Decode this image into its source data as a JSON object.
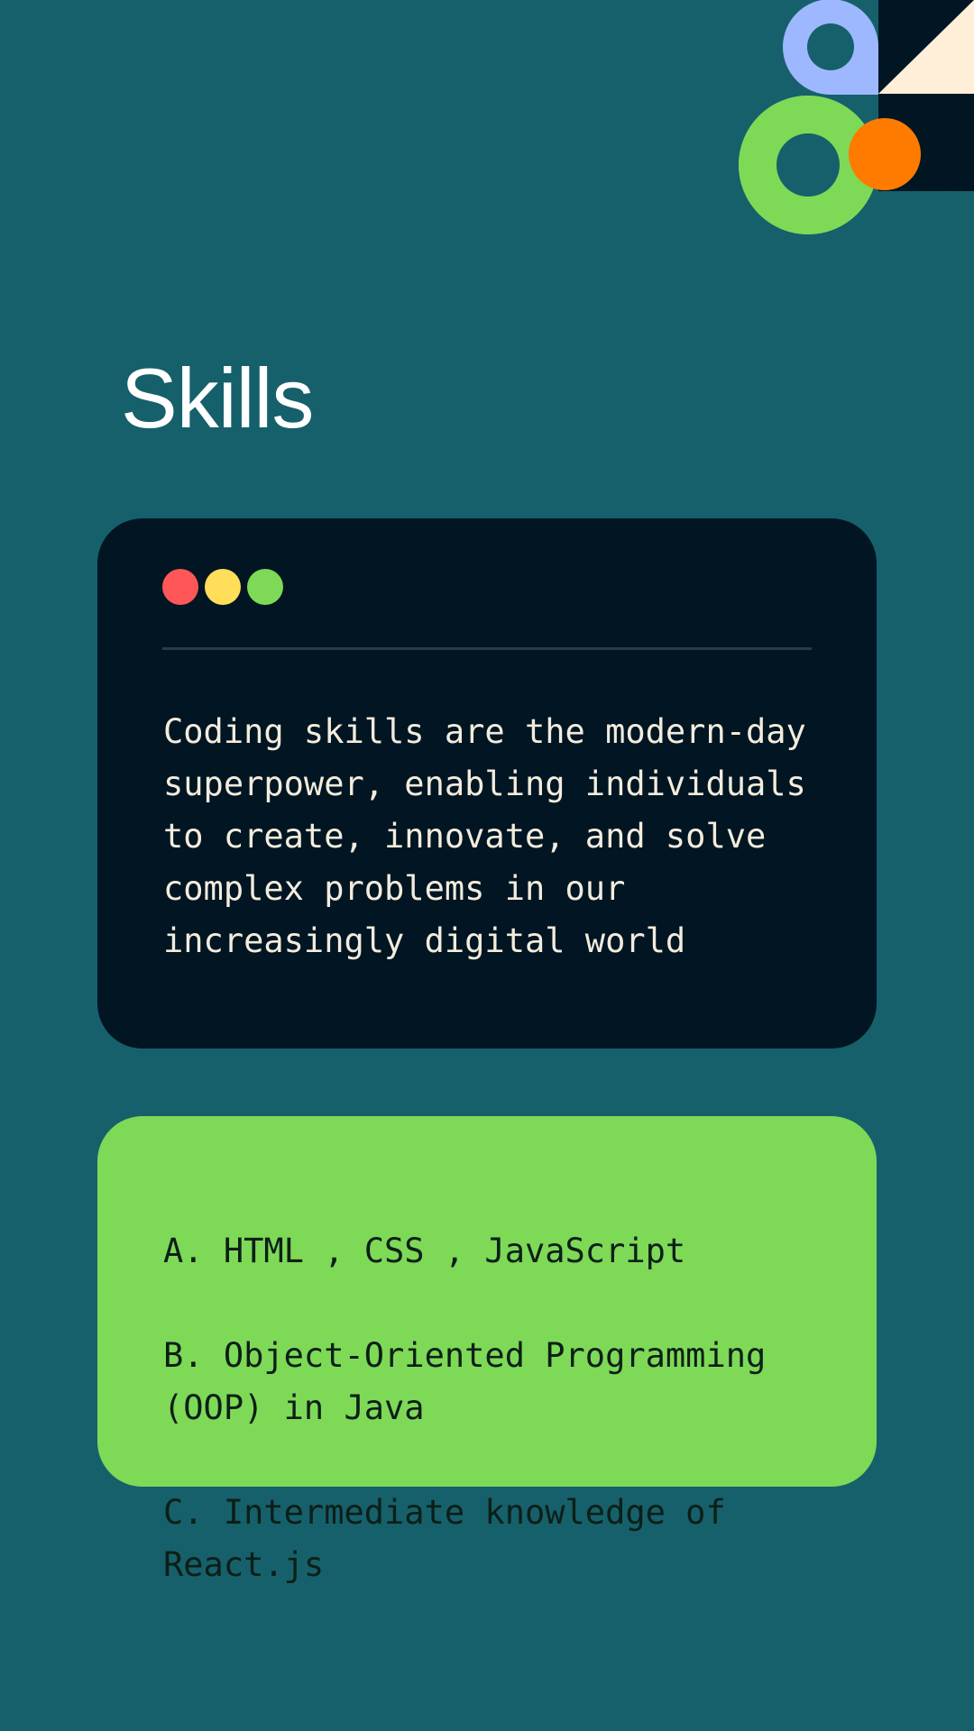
{
  "page": {
    "title": "Skills"
  },
  "colors": {
    "background": "#16606b",
    "terminal_bg": "#011523",
    "terminal_text": "#f3ecdc",
    "skills_bg": "#7ed957",
    "skills_text": "#0b1f17",
    "dot_red": "#ff5757",
    "dot_yellow": "#ffde59",
    "dot_green": "#7ed957",
    "shape_lavender": "#9db8ff",
    "shape_cream": "#ffeed8",
    "shape_navy": "#011523",
    "shape_green": "#7ed957",
    "shape_orange": "#ff7b00"
  },
  "terminal": {
    "window_controls": [
      "red-dot",
      "yellow-dot",
      "green-dot"
    ],
    "body": "Coding skills are the modern-day\nsuperpower, enabling individuals\nto create, innovate, and solve\ncomplex problems in our\nincreasingly digital world"
  },
  "skills": {
    "items": [
      "A. HTML , CSS , JavaScript",
      "B. Object-Oriented Programming\n(OOP) in Java",
      "C. Intermediate knowledge of\nReact.js"
    ]
  }
}
